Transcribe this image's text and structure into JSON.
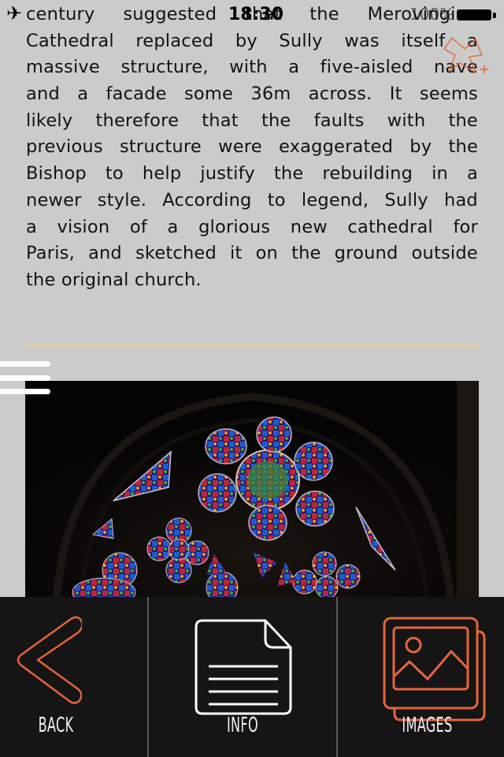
{
  "status_bar": {
    "time": "18:30",
    "battery_percent": "100%",
    "airplane_mode": "airplane-icon"
  },
  "article": {
    "lines": [
      "century suggested that the Merovingian",
      "Cathedral replaced by Sully was itself a",
      "massive structure, with a five-aisled nave",
      "and a facade some 36m across. It seems",
      "likely therefore that the faults with the",
      "previous structure were exaggerated by the",
      "Bishop to help justify the rebuilding in a",
      "newer style. According to legend, Sully had",
      "a vision of a glorious new cathedral for",
      "Paris, and sketched it on the ground outside",
      "the original church."
    ]
  },
  "colors": {
    "background": "#cbcbcb",
    "accent": "#e8643a",
    "divider": "#e3d2a6",
    "tab_bar": "#151515"
  },
  "photo": {
    "alt": "Notre-Dame stained glass rose window"
  },
  "tab_bar": {
    "tabs": [
      {
        "label": "BACK",
        "icon": "chevron-left-icon"
      },
      {
        "label": "INFO",
        "icon": "document-icon"
      },
      {
        "label": "IMAGES",
        "icon": "image-gallery-icon"
      }
    ]
  }
}
